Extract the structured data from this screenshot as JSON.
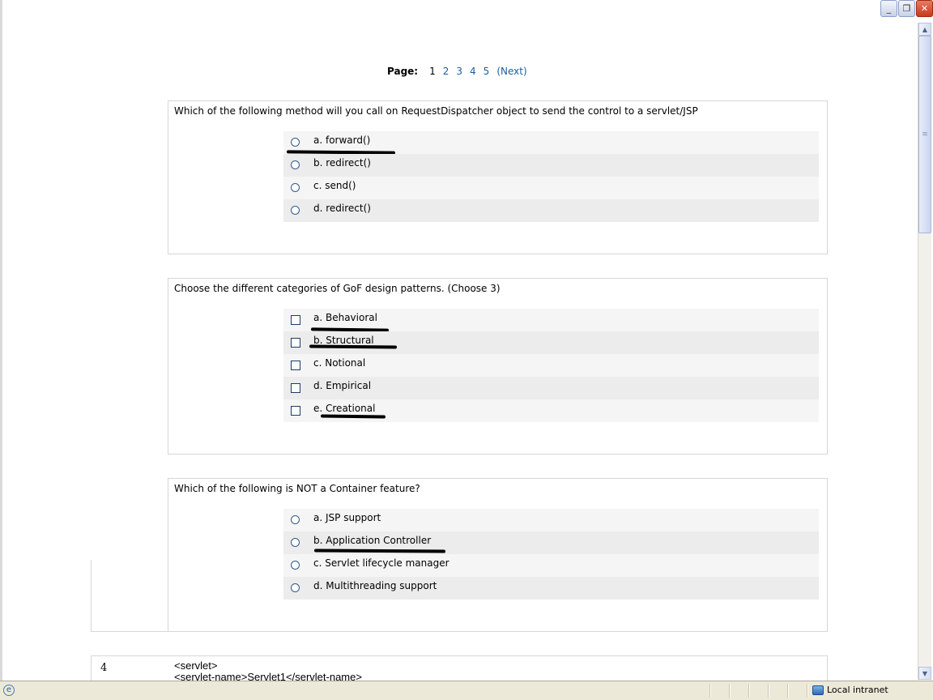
{
  "pager": {
    "label": "Page:",
    "current": "1",
    "pages": [
      "2",
      "3",
      "4",
      "5"
    ],
    "next": "(Next)"
  },
  "questions": [
    {
      "text": "Which of the following method will you call on RequestDispatcher object to send the control to a servlet/JSP",
      "type": "radio",
      "options": [
        "a. forward()",
        "b. redirect()",
        "c. send()",
        "d. redirect()"
      ]
    },
    {
      "text": "Choose the different categories of GoF design patterns. (Choose 3)",
      "type": "checkbox",
      "options": [
        "a. Behavioral",
        "b. Structural",
        "c. Notional",
        "d. Empirical",
        "e. Creational"
      ]
    },
    {
      "text": "Which of the following is NOT a Container feature?",
      "type": "radio",
      "options": [
        "a. JSP support",
        "b. Application Controller",
        "c. Servlet lifecycle manager",
        "d. Multithreading support"
      ]
    }
  ],
  "question4": {
    "number": "4",
    "code_line1": "<servlet>",
    "code_line2": "<servlet-name>Servlet1</servlet-name>"
  },
  "statusbar": {
    "zone": "Local intranet",
    "zone_icon": "intranet-icon",
    "page_icon": "ie-page-icon"
  },
  "window": {
    "buttons": [
      "minimize-icon",
      "restore-icon",
      "close-icon"
    ]
  }
}
